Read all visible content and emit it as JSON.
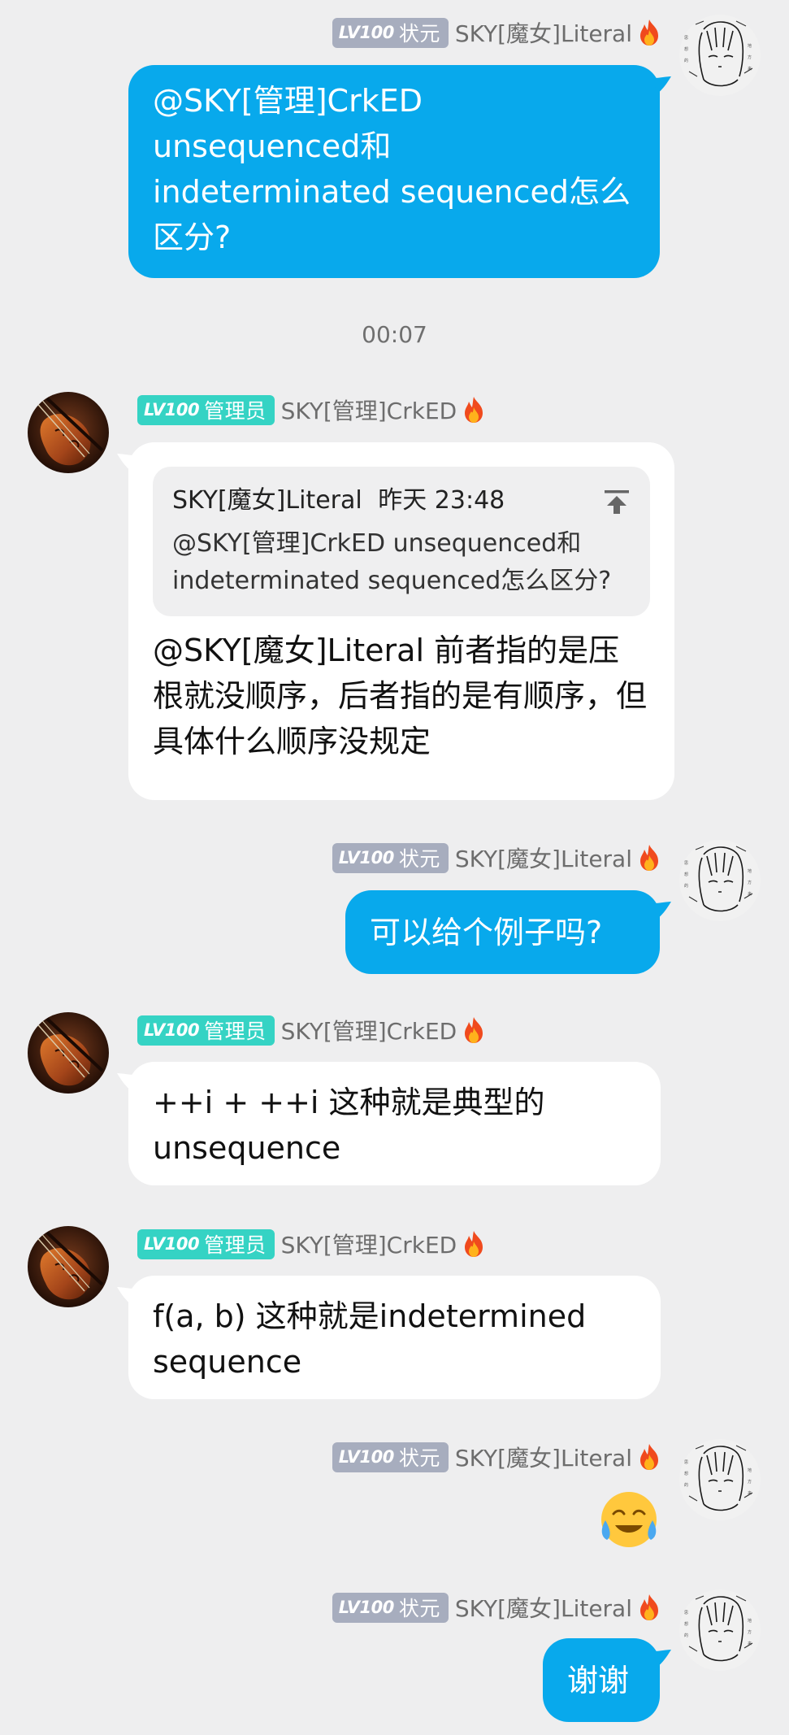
{
  "users": {
    "literal": {
      "badge_lv": "LV100",
      "badge_title": "状元",
      "nickname": "SKY[魔女]Literal"
    },
    "crked": {
      "badge_lv": "LV100",
      "badge_title": "管理员",
      "nickname": "SKY[管理]CrkED"
    }
  },
  "messages": [
    {
      "text": "@SKY[管理]CrkED unsequenced和 indeterminated sequenced怎么区分?"
    },
    {
      "timestamp": "00:07"
    },
    {
      "quote": {
        "author": "SKY[魔女]Literal",
        "time": "昨天 23:48",
        "text": "@SKY[管理]CrkED unsequenced和indeterminated sequenced怎么区分?"
      },
      "text": "@SKY[魔女]Literal 前者指的是压根就没顺序，后者指的是有顺序，但具体什么顺序没规定"
    },
    {
      "text": "可以给个例子吗?"
    },
    {
      "text": "++i + ++i 这种就是典型的unsequence"
    },
    {
      "text": "f(a, b) 这种就是indetermined sequence"
    },
    {
      "sticker": "smiling-face-with-tears-sticker"
    },
    {
      "text": "谢谢"
    }
  ],
  "colors": {
    "outgoing_bubble": "#08a9ec",
    "incoming_bubble": "#ffffff",
    "background": "#eeeeef",
    "badge_gray": "#a7adbe",
    "badge_teal": "#35d3c4"
  },
  "icons": {
    "literal_avatar": "anime-girl-sketch-avatar",
    "crked_avatar": "violin-avatar",
    "flame": "flame-icon",
    "quote_jump": "jump-to-message-icon"
  }
}
